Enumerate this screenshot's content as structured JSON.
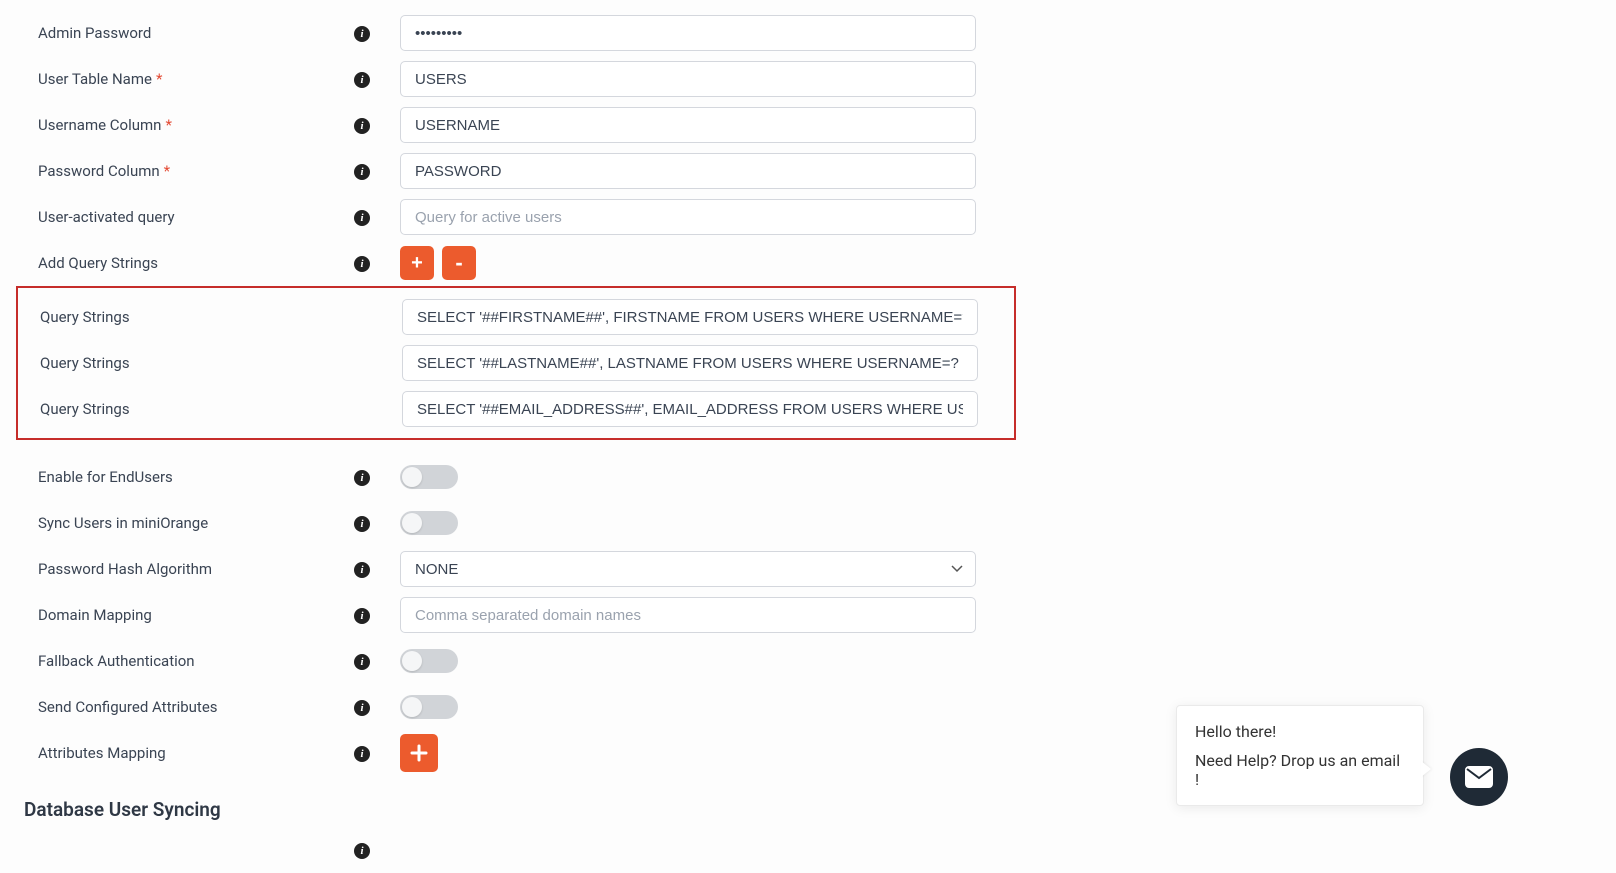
{
  "fields": {
    "adminPassword": {
      "label": "Admin Password",
      "value": "•••••••••"
    },
    "userTable": {
      "label": "User Table Name",
      "value": "USERS",
      "required": true
    },
    "usernameCol": {
      "label": "Username Column",
      "value": "USERNAME",
      "required": true
    },
    "passwordCol": {
      "label": "Password Column",
      "value": "PASSWORD",
      "required": true
    },
    "activeQuery": {
      "label": "User-activated query",
      "placeholder": "Query for active users"
    },
    "addQuery": {
      "label": "Add Query Strings"
    },
    "queryStrings": [
      {
        "label": "Query Strings",
        "value": "SELECT '##FIRSTNAME##', FIRSTNAME FROM USERS WHERE USERNAME=?"
      },
      {
        "label": "Query Strings",
        "value": "SELECT '##LASTNAME##', LASTNAME FROM USERS WHERE USERNAME=?"
      },
      {
        "label": "Query Strings",
        "value": "SELECT '##EMAIL_ADDRESS##', EMAIL_ADDRESS FROM USERS WHERE USERNAME=?"
      }
    ],
    "enableEndUsers": {
      "label": "Enable for EndUsers"
    },
    "syncUsers": {
      "label": "Sync Users in miniOrange"
    },
    "hashAlgo": {
      "label": "Password Hash Algorithm",
      "value": "NONE"
    },
    "domainMapping": {
      "label": "Domain Mapping",
      "placeholder": "Comma separated domain names"
    },
    "fallbackAuth": {
      "label": "Fallback Authentication"
    },
    "sendAttrs": {
      "label": "Send Configured Attributes"
    },
    "attrsMapping": {
      "label": "Attributes Mapping"
    }
  },
  "section": {
    "title": "Database User Syncing"
  },
  "buttons": {
    "plus": "+",
    "minus": "-"
  },
  "chat": {
    "greeting": "Hello there!",
    "help": "Need Help? Drop us an email !"
  }
}
